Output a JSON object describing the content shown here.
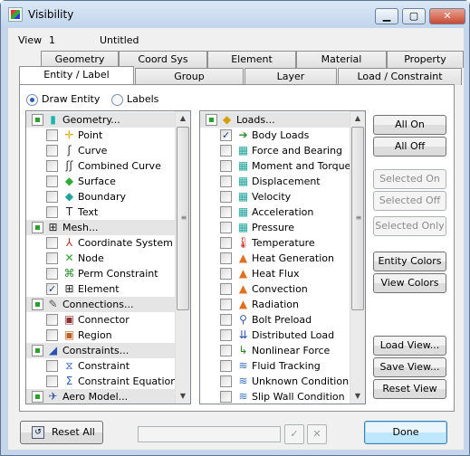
{
  "window": {
    "title": "Visibility",
    "minimize": "▁",
    "maximize": "▢",
    "close": "✕"
  },
  "header": {
    "view_label": "View",
    "view_num": "1",
    "view_name": "Untitled"
  },
  "tabs_row1": [
    "Geometry",
    "Coord Sys",
    "Element",
    "Material",
    "Property"
  ],
  "tabs_row2": [
    "Entity / Label",
    "Group",
    "Layer",
    "Load / Constraint"
  ],
  "active_tab": "Entity / Label",
  "draw_options": {
    "draw_entity": "Draw Entity",
    "labels": "Labels",
    "selected": "Draw Entity"
  },
  "left_list": [
    {
      "type": "group",
      "label": "Geometry...",
      "icon": "geometry-icon"
    },
    {
      "type": "item",
      "label": "Point",
      "checked": false,
      "icon": "point-icon"
    },
    {
      "type": "item",
      "label": "Curve",
      "checked": false,
      "icon": "curve-icon"
    },
    {
      "type": "item",
      "label": "Combined Curve",
      "checked": false,
      "icon": "combined-curve-icon"
    },
    {
      "type": "item",
      "label": "Surface",
      "checked": false,
      "icon": "surface-icon"
    },
    {
      "type": "item",
      "label": "Boundary",
      "checked": false,
      "icon": "boundary-icon"
    },
    {
      "type": "item",
      "label": "Text",
      "checked": false,
      "icon": "text-icon"
    },
    {
      "type": "group",
      "label": "Mesh...",
      "icon": "mesh-icon"
    },
    {
      "type": "item",
      "label": "Coordinate System",
      "checked": false,
      "icon": "coordinate-system-icon"
    },
    {
      "type": "item",
      "label": "Node",
      "checked": false,
      "icon": "node-icon"
    },
    {
      "type": "item",
      "label": "Perm Constraint",
      "checked": false,
      "icon": "perm-constraint-icon"
    },
    {
      "type": "item",
      "label": "Element",
      "checked": true,
      "icon": "element-icon"
    },
    {
      "type": "group",
      "label": "Connections...",
      "icon": "connections-icon"
    },
    {
      "type": "item",
      "label": "Connector",
      "checked": false,
      "icon": "connector-icon"
    },
    {
      "type": "item",
      "label": "Region",
      "checked": false,
      "icon": "region-icon"
    },
    {
      "type": "group",
      "label": "Constraints...",
      "icon": "constraints-icon"
    },
    {
      "type": "item",
      "label": "Constraint",
      "checked": false,
      "icon": "constraint-icon"
    },
    {
      "type": "item",
      "label": "Constraint Equation",
      "checked": false,
      "icon": "constraint-equation-icon"
    },
    {
      "type": "group",
      "label": "Aero Model...",
      "icon": "aero-model-icon"
    }
  ],
  "right_list": [
    {
      "type": "group",
      "label": "Loads...",
      "icon": "loads-icon"
    },
    {
      "type": "item",
      "label": "Body Loads",
      "checked": true,
      "icon": "body-loads-icon"
    },
    {
      "type": "item",
      "label": "Force and Bearing",
      "checked": false,
      "icon": "force-bearing-icon"
    },
    {
      "type": "item",
      "label": "Moment and Torque",
      "checked": false,
      "icon": "moment-torque-icon"
    },
    {
      "type": "item",
      "label": "Displacement",
      "checked": false,
      "icon": "displacement-icon"
    },
    {
      "type": "item",
      "label": "Velocity",
      "checked": false,
      "icon": "velocity-icon"
    },
    {
      "type": "item",
      "label": "Acceleration",
      "checked": false,
      "icon": "acceleration-icon"
    },
    {
      "type": "item",
      "label": "Pressure",
      "checked": false,
      "icon": "pressure-icon"
    },
    {
      "type": "item",
      "label": "Temperature",
      "checked": false,
      "icon": "temperature-icon"
    },
    {
      "type": "item",
      "label": "Heat Generation",
      "checked": false,
      "icon": "heat-generation-icon"
    },
    {
      "type": "item",
      "label": "Heat Flux",
      "checked": false,
      "icon": "heat-flux-icon"
    },
    {
      "type": "item",
      "label": "Convection",
      "checked": false,
      "icon": "convection-icon"
    },
    {
      "type": "item",
      "label": "Radiation",
      "checked": false,
      "icon": "radiation-icon"
    },
    {
      "type": "item",
      "label": "Bolt Preload",
      "checked": false,
      "icon": "bolt-preload-icon"
    },
    {
      "type": "item",
      "label": "Distributed Load",
      "checked": false,
      "icon": "distributed-load-icon"
    },
    {
      "type": "item",
      "label": "Nonlinear Force",
      "checked": false,
      "icon": "nonlinear-force-icon"
    },
    {
      "type": "item",
      "label": "Fluid Tracking",
      "checked": false,
      "icon": "fluid-tracking-icon"
    },
    {
      "type": "item",
      "label": "Unknown Condition",
      "checked": false,
      "icon": "unknown-condition-icon"
    },
    {
      "type": "item",
      "label": "Slip Wall Condition",
      "checked": false,
      "icon": "slip-wall-icon"
    }
  ],
  "side_buttons": {
    "all_on": "All On",
    "all_off": "All Off",
    "selected_on": "Selected On",
    "selected_off": "Selected Off",
    "selected_only": "Selected Only",
    "entity_colors": "Entity Colors",
    "view_colors": "View Colors",
    "load_view": "Load View...",
    "save_view": "Save View...",
    "reset_view": "Reset View"
  },
  "footer": {
    "reset_all": "Reset All",
    "done": "Done"
  },
  "icon_glyphs": {
    "geometry-icon": {
      "g": "▮",
      "c": "#19b6b0"
    },
    "point-icon": {
      "g": "✛",
      "c": "#e0a800"
    },
    "curve-icon": {
      "g": "ʃ",
      "c": "#333333"
    },
    "combined-curve-icon": {
      "g": "ʃʃ",
      "c": "#333333"
    },
    "surface-icon": {
      "g": "◆",
      "c": "#35a838"
    },
    "boundary-icon": {
      "g": "◆",
      "c": "#1fa39a"
    },
    "text-icon": {
      "g": "T",
      "c": "#222222"
    },
    "mesh-icon": {
      "g": "⊞",
      "c": "#222222"
    },
    "coordinate-system-icon": {
      "g": "⅄",
      "c": "#b03030"
    },
    "node-icon": {
      "g": "✕",
      "c": "#2aa12a"
    },
    "perm-constraint-icon": {
      "g": "⌘",
      "c": "#2a8a2a"
    },
    "element-icon": {
      "g": "⊞",
      "c": "#222222"
    },
    "connections-icon": {
      "g": "✎",
      "c": "#555555"
    },
    "connector-icon": {
      "g": "▣",
      "c": "#8a3030"
    },
    "region-icon": {
      "g": "▣",
      "c": "#c06020"
    },
    "constraints-icon": {
      "g": "◢",
      "c": "#2a50b0"
    },
    "constraint-icon": {
      "g": "⧖",
      "c": "#3060c0"
    },
    "constraint-equation-icon": {
      "g": "Σ",
      "c": "#3060c0"
    },
    "aero-model-icon": {
      "g": "✈",
      "c": "#3a5aa0"
    },
    "loads-icon": {
      "g": "◆",
      "c": "#d4a000"
    },
    "body-loads-icon": {
      "g": "➔",
      "c": "#2a8a2a"
    },
    "force-bearing-icon": {
      "g": "▦",
      "c": "#1fa39a"
    },
    "moment-torque-icon": {
      "g": "▦",
      "c": "#1fa39a"
    },
    "displacement-icon": {
      "g": "▦",
      "c": "#1fa39a"
    },
    "velocity-icon": {
      "g": "▦",
      "c": "#1fa39a"
    },
    "acceleration-icon": {
      "g": "▦",
      "c": "#1fa39a"
    },
    "pressure-icon": {
      "g": "▦",
      "c": "#1fa39a"
    },
    "temperature-icon": {
      "g": "🌡",
      "c": "#d02020"
    },
    "heat-generation-icon": {
      "g": "▲",
      "c": "#e07020"
    },
    "heat-flux-icon": {
      "g": "▲",
      "c": "#e07020"
    },
    "convection-icon": {
      "g": "▲",
      "c": "#e07020"
    },
    "radiation-icon": {
      "g": "▲",
      "c": "#e07020"
    },
    "bolt-preload-icon": {
      "g": "⚲",
      "c": "#3a5aa0"
    },
    "distributed-load-icon": {
      "g": "⇊",
      "c": "#2a50b0"
    },
    "nonlinear-force-icon": {
      "g": "↳",
      "c": "#2a8a2a"
    },
    "fluid-tracking-icon": {
      "g": "≋",
      "c": "#3a70c0"
    },
    "unknown-condition-icon": {
      "g": "≋",
      "c": "#3a70c0"
    },
    "slip-wall-icon": {
      "g": "≋",
      "c": "#3a70c0"
    }
  }
}
